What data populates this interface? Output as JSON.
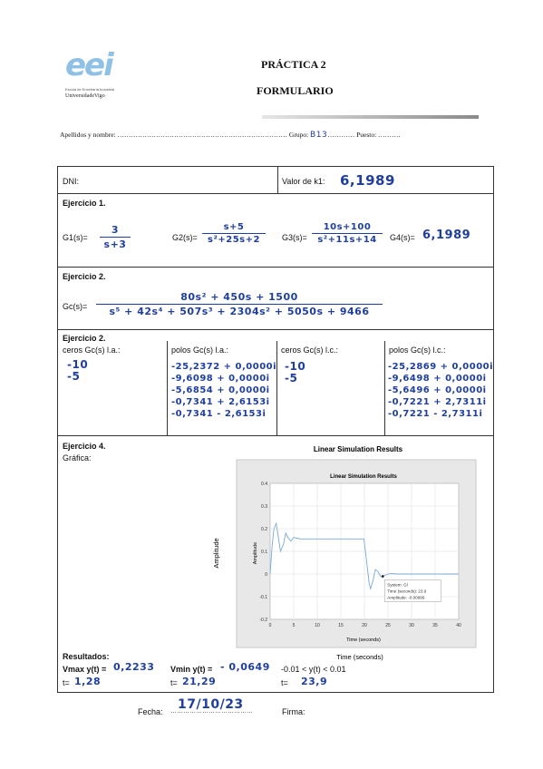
{
  "header": {
    "logo_text": "eei",
    "logo_school": "Escola de Enxeñaría Industrial",
    "logo_university": "UniversidadeVigo",
    "title": "PRÁCTICA 2",
    "subtitle": "FORMULARIO"
  },
  "student_line": {
    "name_label": "Apellidos y nombre:",
    "name_dots": "…………………………………………………………………",
    "group_label": "Grupo:",
    "group_value": "B13",
    "group_dots": "…………",
    "seat_label": "Puesto:",
    "seat_dots": "………."
  },
  "dni": {
    "label": "DNI:",
    "value": ""
  },
  "k1": {
    "label": "Valor de k1:",
    "value": "6,1989"
  },
  "ex1": {
    "title": "Ejercicio 1.",
    "g1_label": "G1(s)=",
    "g1_num": "3",
    "g1_den": "s+3",
    "g2_label": "G2(s)=",
    "g2_num": "s+5",
    "g2_den": "s²+25s+2",
    "g3_label": "G3(s)=",
    "g3_num": "10s+100",
    "g3_den": "s²+11s+14",
    "g4_label": "G4(s)=",
    "g4_value": "6,1989"
  },
  "ex2": {
    "title": "Ejercicio 2.",
    "gc_label": "Gc(s)=",
    "gc_num": "80s² + 450s + 1500",
    "gc_den": "s⁵ + 42s⁴ + 507s³ + 2304s² + 5050s + 9466"
  },
  "ex3": {
    "title": "Ejercicio 2.",
    "ceros_la_label": "ceros Gc(s) l.a.:",
    "ceros_la": [
      "-10",
      "-5"
    ],
    "polos_la_label": "polos Gc(s) l.a.:",
    "polos_la": [
      "-25,2372 + 0,0000i",
      "-9,6098 + 0,0000i",
      "-5,6854 + 0,0000i",
      "-0,7341 + 2,6153i",
      "-0,7341 - 2,6153i"
    ],
    "ceros_lc_label": "ceros Gc(s) l.c.:",
    "ceros_lc": [
      "-10",
      "-5"
    ],
    "polos_lc_label": "polos Gc(s) l.c.:",
    "polos_lc": [
      "-25,2869 + 0,0000i",
      "-9,6498 + 0,0000i",
      "-5,6496 + 0,0000i",
      "-0,7221 + 2,7311i",
      "-0,7221 - 2,7311i"
    ]
  },
  "ex4": {
    "title": "Ejercicio 4.",
    "graph_label": "Gráfica:",
    "results_label": "Resultados:",
    "vmax_label": "Vmax y(t) =",
    "vmax_value": "0,2233",
    "tmax_label": "t=",
    "tmax_value": "1,28",
    "vmin_label": "Vmin y(t) =",
    "vmin_value": "- 0,0649",
    "tmin_label": "t=",
    "tmin_value": "21,29",
    "settle_label": "-0.01 < y(t) < 0.01",
    "tsettle_label": "t=",
    "tsettle_value": "23,9"
  },
  "footer": {
    "date_label": "Fecha:",
    "date_value": "17/10/23",
    "date_dots": "…………………………………",
    "sign_label": "Firma:"
  },
  "chart_data": {
    "type": "line",
    "outer_title": "Linear Simulation Results",
    "title": "Linear Simulation Results",
    "xlabel": "Time (seconds)",
    "ylabel": "Amplitude",
    "xlim": [
      0,
      40
    ],
    "ylim": [
      -0.2,
      0.4
    ],
    "xticks": [
      0,
      5,
      10,
      15,
      20,
      25,
      30,
      35,
      40
    ],
    "yticks": [
      -0.2,
      -0.1,
      0,
      0.1,
      0.2,
      0.3,
      0.4
    ],
    "grid": true,
    "series": [
      {
        "color": "#7aaad6",
        "x": [
          0,
          0.4,
          0.8,
          1.28,
          1.7,
          2.2,
          2.8,
          3.3,
          3.8,
          4.4,
          5.0,
          5.6,
          6.5,
          8,
          10,
          15,
          19.9,
          20.5,
          21.0,
          21.29,
          21.8,
          22.3,
          22.9,
          23.5,
          23.9,
          24.5,
          25.5,
          27,
          30,
          35,
          40
        ],
        "y": [
          0,
          0.12,
          0.2,
          0.2233,
          0.17,
          0.1,
          0.13,
          0.18,
          0.16,
          0.145,
          0.162,
          0.158,
          0.155,
          0.155,
          0.155,
          0.155,
          0.155,
          0.05,
          -0.04,
          -0.0649,
          -0.03,
          0.02,
          0.01,
          -0.012,
          -0.00999,
          -0.004,
          0.002,
          0.0,
          0.0,
          0.0,
          0.0
        ]
      }
    ],
    "datatip": {
      "x": 23.9,
      "y": -0.00999,
      "lines": [
        "System: Gl",
        "Time (seconds): 23.9",
        "Amplitude: -0.00999"
      ]
    },
    "outer_xlabel": "Time (seconds)",
    "outer_ylabel": "Amplitude"
  }
}
